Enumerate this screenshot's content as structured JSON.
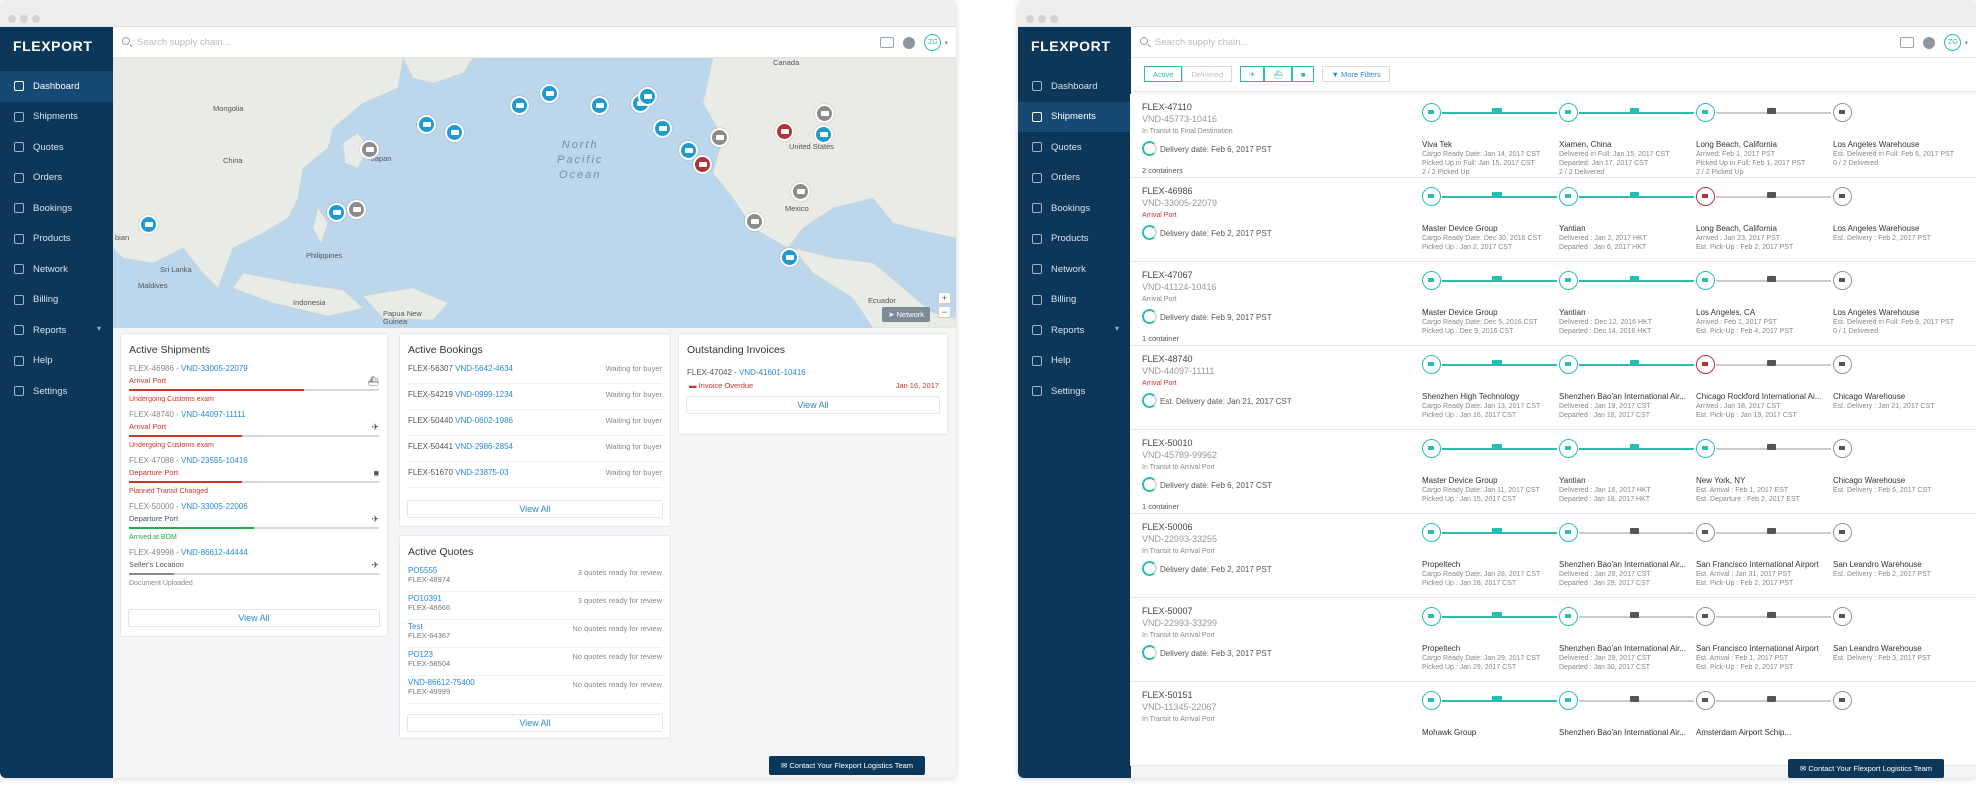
{
  "app": {
    "logo": "FLEXPORT",
    "search_placeholder": "Search supply chain...",
    "avatar": "ZG"
  },
  "nav": [
    {
      "label": "Dashboard",
      "icon": "dashboard-icon"
    },
    {
      "label": "Shipments",
      "icon": "shipments-icon"
    },
    {
      "label": "Quotes",
      "icon": "quotes-icon"
    },
    {
      "label": "Orders",
      "icon": "orders-icon"
    },
    {
      "label": "Bookings",
      "icon": "bookings-icon"
    },
    {
      "label": "Products",
      "icon": "products-icon"
    },
    {
      "label": "Network",
      "icon": "network-icon"
    },
    {
      "label": "Billing",
      "icon": "billing-icon"
    },
    {
      "label": "Reports",
      "icon": "reports-icon"
    },
    {
      "label": "Help",
      "icon": "help-icon"
    },
    {
      "label": "Settings",
      "icon": "settings-icon"
    }
  ],
  "map": {
    "labels": [
      "Canada",
      "Mongolia",
      "China",
      "Japan",
      "United States",
      "Mexico",
      "Sri Lanka",
      "Maldives",
      "Philippines",
      "Indonesia",
      "Papua New Guinea",
      "Ecuador",
      "bian"
    ],
    "ocean": [
      "North",
      "Pacific",
      "Ocean"
    ],
    "network_button": "Network",
    "zoom_in": "+",
    "zoom_out": "−"
  },
  "active_shipments": {
    "title": "Active Shipments",
    "items": [
      {
        "id": "FLEX-46986",
        "vnd": "VND-33005-22079",
        "status": "Arrival Port",
        "sub": "Undergoing Customs exam",
        "mode": "ocean",
        "progress": 0.7,
        "color": "#d0342c"
      },
      {
        "id": "FLEX-48740",
        "vnd": "VND-44097-11111",
        "status": "Arrival Port",
        "sub": "Undergoing Customs exam",
        "mode": "air",
        "progress": 0.45,
        "color": "#d0342c"
      },
      {
        "id": "FLEX-47088",
        "vnd": "VND-23555-10416",
        "status": "Departure Port",
        "sub": "Planned Transit Changed",
        "mode": "truck",
        "progress": 0.45,
        "color": "#d0342c"
      },
      {
        "id": "FLEX-50000",
        "vnd": "VND-33005-22006",
        "status": "Departure Port",
        "sub": "Arrived at BOM",
        "mode": "air",
        "progress": 0.5,
        "color": "#2ba84a"
      },
      {
        "id": "FLEX-49998",
        "vnd": "VND-86612-44444",
        "status": "Seller's Location",
        "sub": "Document Uploaded",
        "mode": "air",
        "progress": 0.18,
        "color": "#888888"
      }
    ],
    "view_all": "View All"
  },
  "active_bookings": {
    "title": "Active Bookings",
    "items": [
      {
        "id": "FLEX-56307",
        "vnd": "VND-5642-4634",
        "status": "Waiting for buyer"
      },
      {
        "id": "FLEX-54219",
        "vnd": "VND-0999-1234",
        "status": "Waiting for buyer"
      },
      {
        "id": "FLEX-50440",
        "vnd": "VND-0602-1986",
        "status": "Waiting for buyer"
      },
      {
        "id": "FLEX-50441",
        "vnd": "VND-2986-2854",
        "status": "Waiting for buyer"
      },
      {
        "id": "FLEX-51670",
        "vnd": "VND-23875-03",
        "status": "Waiting for buyer"
      }
    ],
    "view_all": "View All"
  },
  "invoices": {
    "title": "Outstanding Invoices",
    "id": "FLEX-47042",
    "vnd": "VND-41601-10416",
    "status": "Invoice Overdue",
    "date": "Jan 16, 2017",
    "view_all": "View All"
  },
  "active_quotes": {
    "title": "Active Quotes",
    "items": [
      {
        "name": "PO5555",
        "flex": "FLEX-48974",
        "status": "3 quotes ready for review"
      },
      {
        "name": "PO10391",
        "flex": "FLEX-48666",
        "status": "3 quotes ready for review"
      },
      {
        "name": "Test",
        "flex": "FLEX-64367",
        "status": "No quotes ready for review"
      },
      {
        "name": "PO123",
        "flex": "FLEX-58504",
        "status": "No quotes ready for review"
      },
      {
        "name": "VND-86612-75400",
        "flex": "FLEX-49999",
        "status": "No quotes ready for review"
      }
    ],
    "view_all": "View All"
  },
  "contact": "Contact Your Flexport Logistics Team",
  "filters": {
    "active": "Active",
    "delivered": "Delivered",
    "more": "More Filters"
  },
  "shipments": [
    {
      "id": "FLEX-47110",
      "vnd": "VND-45773-10416",
      "status": "In Transit to Final Destination",
      "status_color": "#888888",
      "delivery": "Delivery date: Feb 6, 2017 PST",
      "containers": "2 containers",
      "stops": [
        {
          "name": "Viva Tek",
          "l1": "Cargo Ready Date: Jan 14, 2017 CST",
          "l2": "Picked Up in Full: Jan 15, 2017 CST",
          "l3": "2 / 2 Picked Up",
          "icon": "factory-icon",
          "state": "done"
        },
        {
          "name": "Xiamen, China",
          "l1": "Delivered in Full: Jan 15, 2017 CST",
          "l2": "Departed: Jan 17, 2017 CST",
          "l3": "2 / 2 Delivered",
          "icon": "ship-icon",
          "state": "done"
        },
        {
          "name": "Long Beach, California",
          "l1": "Arrived: Feb 1, 2017 PST",
          "l2": "Picked Up in Full: Feb 1, 2017 PST",
          "l3": "2 / 2 Picked Up",
          "icon": "ship-icon",
          "state": "done"
        },
        {
          "name": "Los Angeles Warehouse",
          "l1": "Est. Delivered in Full: Feb 6, 2017 PST",
          "l2": "0 / 2 Delivered",
          "l3": "",
          "icon": "warehouse-icon",
          "state": "todo"
        }
      ]
    },
    {
      "id": "FLEX-46986",
      "vnd": "VND-33005-22079",
      "status": "Arrival Port",
      "status_color": "#d0342c",
      "delivery": "Delivery date: Feb 2, 2017 PST",
      "containers": "",
      "stops": [
        {
          "name": "Master Device Group",
          "l1": "Cargo Ready Date: Dec 30, 2016 CST",
          "l2": "Picked Up : Jan 2, 2017 CST",
          "l3": "",
          "icon": "factory-icon",
          "state": "done"
        },
        {
          "name": "Yantian",
          "l1": "Delivered : Jan 2, 2017 HKT",
          "l2": "Departed : Jan 6, 2017 HKT",
          "l3": "",
          "icon": "ship-icon",
          "state": "done"
        },
        {
          "name": "Long Beach, California",
          "l1": "Arrived : Jan 23, 2017 PST",
          "l2": "Est. Pick-Up : Feb 2, 2017 PST",
          "l3": "",
          "icon": "ship-icon",
          "state": "alert"
        },
        {
          "name": "Los Angeles Warehouse",
          "l1": "Est. Delivery : Feb 2, 2017 PST",
          "l2": "",
          "l3": "",
          "icon": "warehouse-icon",
          "state": "todo"
        }
      ]
    },
    {
      "id": "FLEX-47067",
      "vnd": "VND-41124-10416",
      "status": "Arrival Port",
      "status_color": "#888888",
      "delivery": "Delivery date: Feb 9, 2017 PST",
      "containers": "1 container",
      "stops": [
        {
          "name": "Master Device Group",
          "l1": "Cargo Ready Date: Dec 5, 2016 CST",
          "l2": "Picked Up : Dec 9, 2016 CST",
          "l3": "",
          "icon": "factory-icon",
          "state": "done"
        },
        {
          "name": "Yantian",
          "l1": "Delivered : Dec 12, 2016 HKT",
          "l2": "Departed : Dec 14, 2016 HKT",
          "l3": "",
          "icon": "ship-icon",
          "state": "done"
        },
        {
          "name": "Los Angeles, CA",
          "l1": "Arrived : Feb 1, 2017 PST",
          "l2": "Est. Pick-Up : Feb 4, 2017 PST",
          "l3": "",
          "icon": "ship-icon",
          "state": "done"
        },
        {
          "name": "Los Angeles Warehouse",
          "l1": "Est. Delivered in Full: Feb 9, 2017 PST",
          "l2": "0 / 1 Delivered",
          "l3": "",
          "icon": "warehouse-icon",
          "state": "todo"
        }
      ]
    },
    {
      "id": "FLEX-48740",
      "vnd": "VND-44097-11111",
      "status": "Arrival Port",
      "status_color": "#d0342c",
      "delivery": "Est. Delivery date: Jan 21, 2017 CST",
      "containers": "",
      "stops": [
        {
          "name": "Shenzhen High Technology",
          "l1": "Cargo Ready Date: Jan 13, 2017 CST",
          "l2": "Picked Up : Jan 16, 2017 CST",
          "l3": "",
          "icon": "factory-icon",
          "state": "done"
        },
        {
          "name": "Shenzhen Bao'an International Air...",
          "l1": "Delivered : Jan 18, 2017 CST",
          "l2": "Departed : Jan 18, 2017 CST",
          "l3": "",
          "icon": "airport-icon",
          "state": "done"
        },
        {
          "name": "Chicago Rockford International Ai...",
          "l1": "Arrived : Jan 18, 2017 CST",
          "l2": "Est. Pick-Up : Jan 19, 2017 CST",
          "l3": "",
          "icon": "airport-icon",
          "state": "alert"
        },
        {
          "name": "Chicago Warehouse",
          "l1": "Est. Delivery : Jan 21, 2017 CST",
          "l2": "",
          "l3": "",
          "icon": "warehouse-icon",
          "state": "todo"
        }
      ]
    },
    {
      "id": "FLEX-50010",
      "vnd": "VND-45789-99962",
      "status": "In Transit to Arrival Port",
      "status_color": "#888888",
      "delivery": "Delivery date: Feb 6, 2017 CST",
      "containers": "1 container",
      "stops": [
        {
          "name": "Master Device Group",
          "l1": "Cargo Ready Date: Jan 11, 2017 CST",
          "l2": "Picked Up : Jan 15, 2017 CST",
          "l3": "",
          "icon": "factory-icon",
          "state": "done"
        },
        {
          "name": "Yantian",
          "l1": "Delivered : Jan 16, 2017 HKT",
          "l2": "Departed : Jan 18, 2017 HKT",
          "l3": "",
          "icon": "ship-icon",
          "state": "done"
        },
        {
          "name": "New York, NY",
          "l1": "Est. Arrival : Feb 1, 2017 EST",
          "l2": "Est. Departure : Feb 2, 2017 EST",
          "l3": "",
          "icon": "ship-icon",
          "state": "done"
        },
        {
          "name": "Chicago Warehouse",
          "l1": "Est. Delivery : Feb 6, 2017 CST",
          "l2": "",
          "l3": "",
          "icon": "warehouse-icon",
          "state": "todo"
        }
      ]
    },
    {
      "id": "FLEX-50006",
      "vnd": "VND-22993-33255",
      "status": "In Transit to Arrival Port",
      "status_color": "#888888",
      "delivery": "Delivery date: Feb 2, 2017 PST",
      "containers": "",
      "stops": [
        {
          "name": "Propeltech",
          "l1": "Cargo Ready Date: Jan 28, 2017 CST",
          "l2": "Picked Up : Jan 28, 2017 CST",
          "l3": "",
          "icon": "factory-icon",
          "state": "done"
        },
        {
          "name": "Shenzhen Bao'an International Air...",
          "l1": "Delivered : Jan 29, 2017 CST",
          "l2": "Departed : Jan 29, 2017 CST",
          "l3": "",
          "icon": "airport-icon",
          "state": "done"
        },
        {
          "name": "San Francisco International Airport",
          "l1": "Est. Arrival : Jan 31, 2017 PST",
          "l2": "Est. Pick-Up : Feb 2, 2017 PST",
          "l3": "",
          "icon": "airport-icon",
          "state": "todo"
        },
        {
          "name": "San Leandro Warehouse",
          "l1": "Est. Delivery : Feb 2, 2017 PST",
          "l2": "",
          "l3": "",
          "icon": "warehouse-icon",
          "state": "todo"
        }
      ]
    },
    {
      "id": "FLEX-50007",
      "vnd": "VND-22993-33299",
      "status": "In Transit to Arrival Port",
      "status_color": "#888888",
      "delivery": "Delivery date: Feb 3, 2017 PST",
      "containers": "",
      "stops": [
        {
          "name": "Propeltech",
          "l1": "Cargo Ready Date: Jan 29, 2017 CST",
          "l2": "Picked Up : Jan 29, 2017 CST",
          "l3": "",
          "icon": "factory-icon",
          "state": "done"
        },
        {
          "name": "Shenzhen Bao'an International Air...",
          "l1": "Delivered : Jan 29, 2017 CST",
          "l2": "Departed : Jan 30, 2017 CST",
          "l3": "",
          "icon": "airport-icon",
          "state": "done"
        },
        {
          "name": "San Francisco International Airport",
          "l1": "Est. Arrival : Feb 1, 2017 PST",
          "l2": "Est. Pick-Up : Feb 2, 2017 PST",
          "l3": "",
          "icon": "airport-icon",
          "state": "todo"
        },
        {
          "name": "San Leandro Warehouse",
          "l1": "Est. Delivery : Feb 3, 2017 PST",
          "l2": "",
          "l3": "",
          "icon": "warehouse-icon",
          "state": "todo"
        }
      ]
    },
    {
      "id": "FLEX-50151",
      "vnd": "VND-11345-22067",
      "status": "In Transit to Arrival Port",
      "status_color": "#888888",
      "delivery": "",
      "containers": "",
      "stops": [
        {
          "name": "Mohawk Group",
          "l1": "",
          "l2": "",
          "l3": "",
          "icon": "factory-icon",
          "state": "done"
        },
        {
          "name": "Shenzhen Bao'an International Air...",
          "l1": "",
          "l2": "",
          "l3": "",
          "icon": "airport-icon",
          "state": "done"
        },
        {
          "name": "Amsterdam Airport Schip...",
          "l1": "",
          "l2": "",
          "l3": "",
          "icon": "airport-icon",
          "state": "todo"
        },
        {
          "name": "",
          "l1": "",
          "l2": "",
          "l3": "",
          "icon": "warehouse-icon",
          "state": "todo"
        }
      ]
    }
  ],
  "colors": {
    "navy": "#0d3759",
    "teal": "#2bbcb4",
    "link": "#2a8ad2",
    "alert": "#d0342c",
    "map_water": "#bcd6ec",
    "map_land": "#e9ebe6"
  }
}
